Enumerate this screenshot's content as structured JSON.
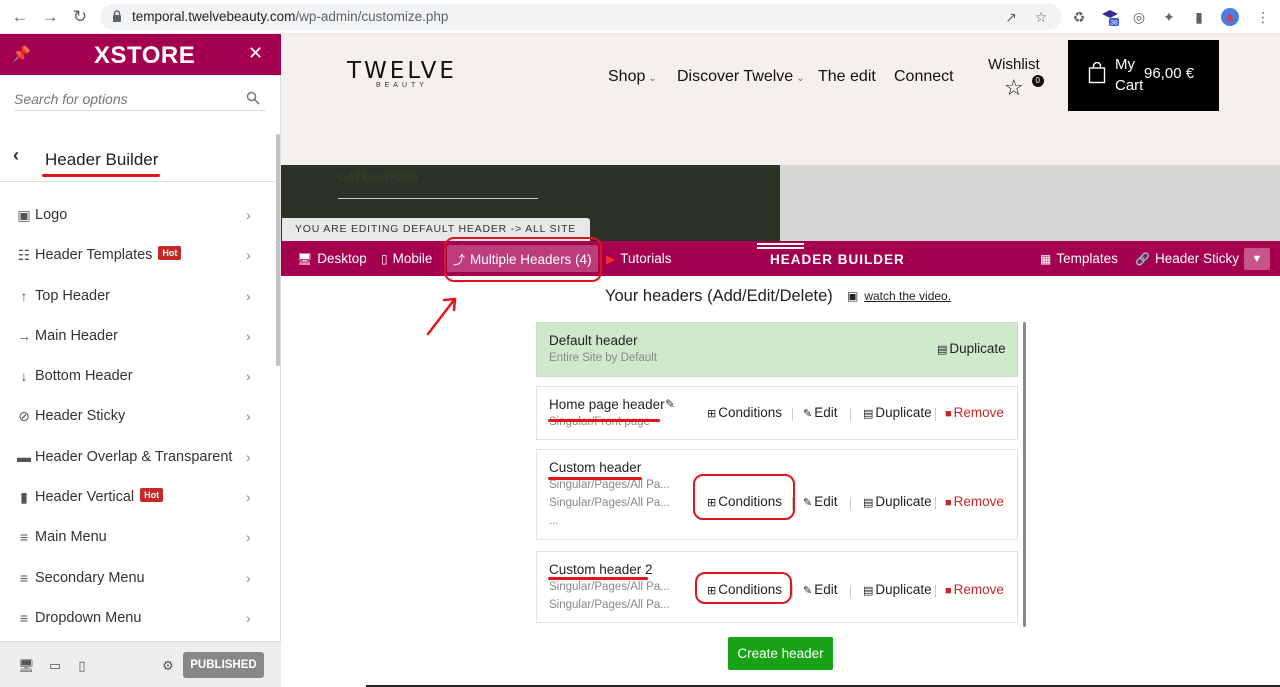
{
  "browser": {
    "url_domain": "temporal.twelvebeauty.com",
    "url_path": "/wp-admin/customize.php",
    "ext_badge": "38"
  },
  "panel": {
    "brand": "XSTORE",
    "search_placeholder": "Search for options",
    "section_title": "Header Builder",
    "items": [
      {
        "label": "Logo",
        "icon": "image-icon",
        "hot": false
      },
      {
        "label": "Header Templates",
        "icon": "grid-icon",
        "hot": true
      },
      {
        "label": "Top Header",
        "icon": "arrow-up-icon",
        "hot": false
      },
      {
        "label": "Main Header",
        "icon": "arrow-right-icon",
        "hot": false
      },
      {
        "label": "Bottom Header",
        "icon": "arrow-down-icon",
        "hot": false
      },
      {
        "label": "Header Sticky",
        "icon": "link-icon",
        "hot": false
      },
      {
        "label": "Header Overlap & Transparent",
        "icon": "layers-icon",
        "hot": false
      },
      {
        "label": "Header Vertical",
        "icon": "vertical-icon",
        "hot": true
      },
      {
        "label": "Main Menu",
        "icon": "menu-icon",
        "hot": false
      },
      {
        "label": "Secondary Menu",
        "icon": "menu-icon",
        "hot": false
      },
      {
        "label": "Dropdown Menu",
        "icon": "menu-icon",
        "hot": false
      }
    ],
    "hot_label": "Hot",
    "publish_label": "PUBLISHED"
  },
  "site": {
    "logo_main": "TWELVE",
    "logo_sub": "BEAUTY",
    "nav": [
      {
        "label": "Shop",
        "caret": true
      },
      {
        "label": "Discover Twelve",
        "caret": true
      },
      {
        "label": "The edit",
        "caret": false
      },
      {
        "label": "Connect",
        "caret": false
      }
    ],
    "wishlist_label": "Wishlist",
    "wishlist_count": "0",
    "cart_label_1": "My",
    "cart_label_2": "Cart",
    "cart_price": "96,00 €",
    "hero_categories": "CATEGORIES",
    "editing_tag": "YOU ARE EDITING DEFAULT HEADER -> ALL SITE"
  },
  "builder": {
    "tabs": {
      "desktop": "Desktop",
      "mobile": "Mobile",
      "multiple": "Multiple Headers (4)",
      "tutorials": "Tutorials"
    },
    "title": "HEADER BUILDER",
    "templates": "Templates",
    "sticky": "Header Sticky",
    "heading": "Your headers (Add/Edit/Delete)",
    "video_link": "watch the video.",
    "create_label": "Create header",
    "actions": {
      "conditions": "Conditions",
      "edit": "Edit",
      "duplicate": "Duplicate",
      "remove": "Remove"
    },
    "headers": [
      {
        "name": "Default header",
        "subs": [
          "Entire Site by Default"
        ]
      },
      {
        "name": "Home page header",
        "subs": [
          "Singular/Front page"
        ]
      },
      {
        "name": "Custom header",
        "subs": [
          "Singular/Pages/All Pa...",
          "Singular/Pages/All Pa...",
          "..."
        ]
      },
      {
        "name": "Custom header 2",
        "subs": [
          "Singular/Pages/All Pa...",
          "Singular/Pages/All Pa..."
        ]
      }
    ]
  },
  "colors": {
    "brand": "#a4004f",
    "default_card": "#cfe9cd",
    "create_button": "#18a316",
    "remove": "#c62828",
    "annotation": "#e0161a"
  }
}
